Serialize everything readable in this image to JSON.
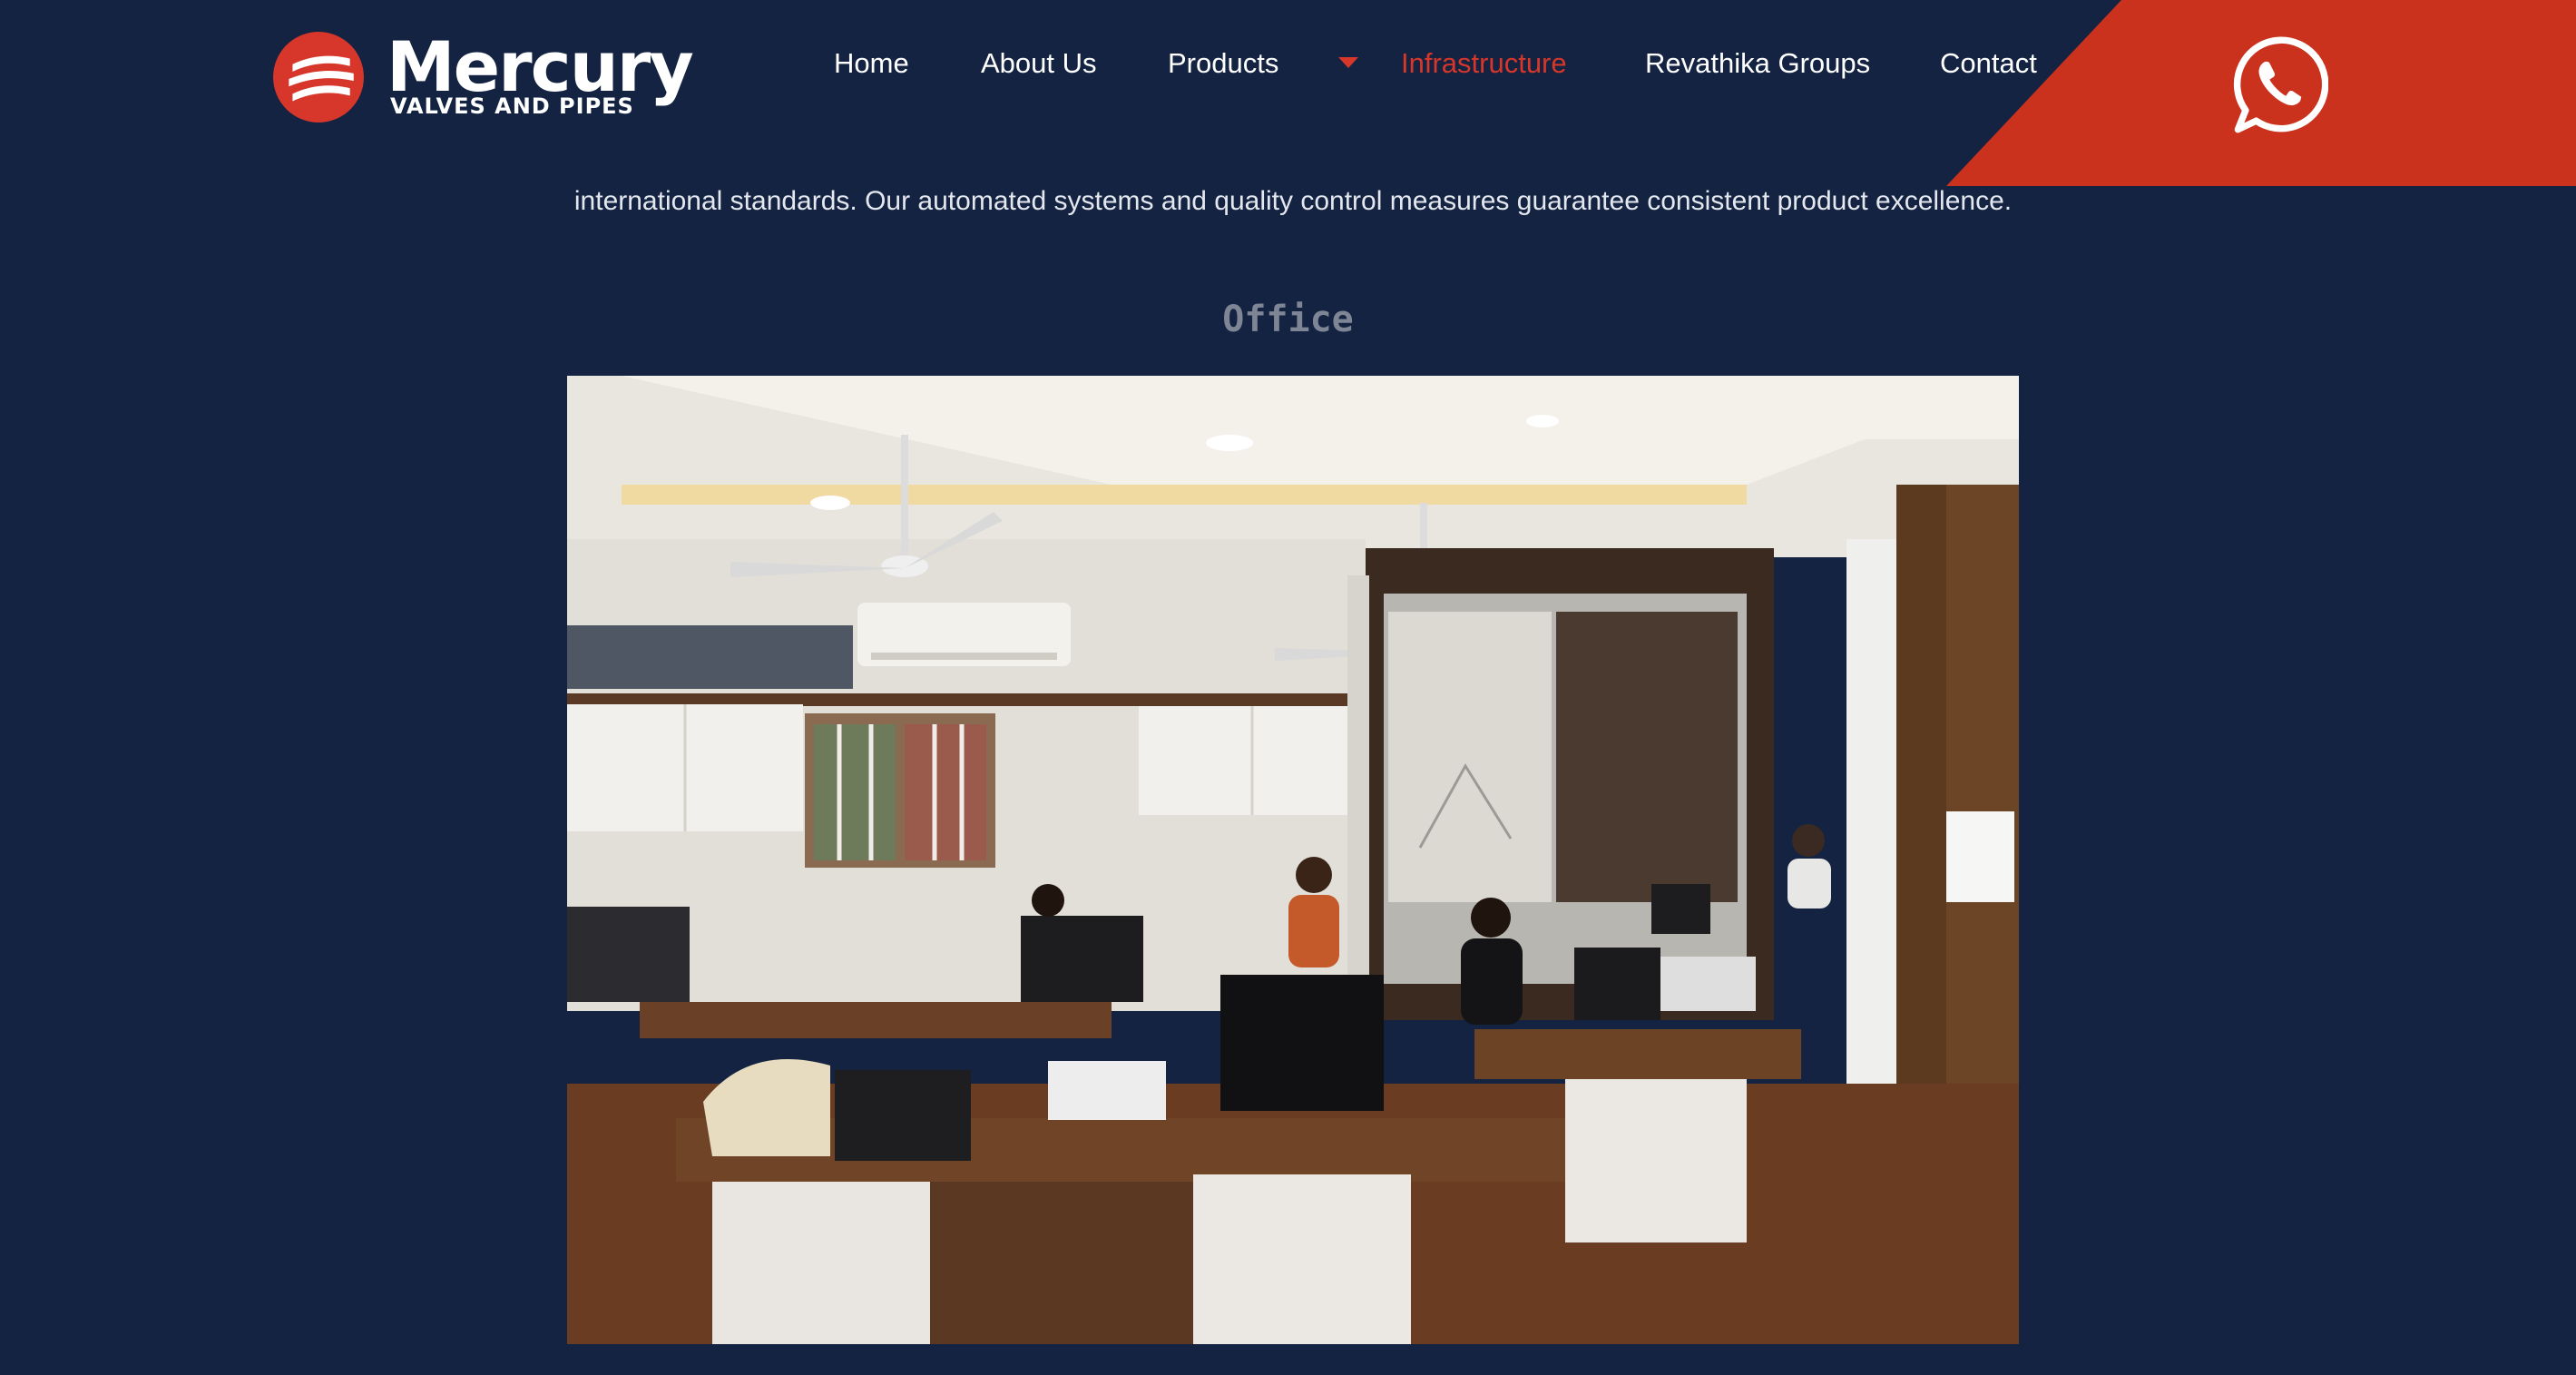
{
  "brand": {
    "name": "Mercury",
    "tagline": "VALVES AND PIPES",
    "logo_icon": "mercury-logo-icon"
  },
  "nav": {
    "items": [
      {
        "label": "Home",
        "active": false
      },
      {
        "label": "About Us",
        "active": false
      },
      {
        "label": "Products",
        "active": false,
        "has_dropdown": true
      },
      {
        "label": "Infrastructure",
        "active": true
      },
      {
        "label": "Revathika Groups",
        "active": false
      },
      {
        "label": "Contact",
        "active": false
      }
    ],
    "dropdown_icon": "caret-down-icon"
  },
  "whatsapp": {
    "icon": "whatsapp-icon"
  },
  "content": {
    "intro_text": "international standards. Our automated systems and quality control measures guarantee consistent product excellence.",
    "section_title": "Office",
    "photo_subject": "office-interior-photo"
  },
  "colors": {
    "background": "#132341",
    "accent": "#d6372a",
    "text": "#ffffff",
    "muted_title": "#7e8696"
  }
}
